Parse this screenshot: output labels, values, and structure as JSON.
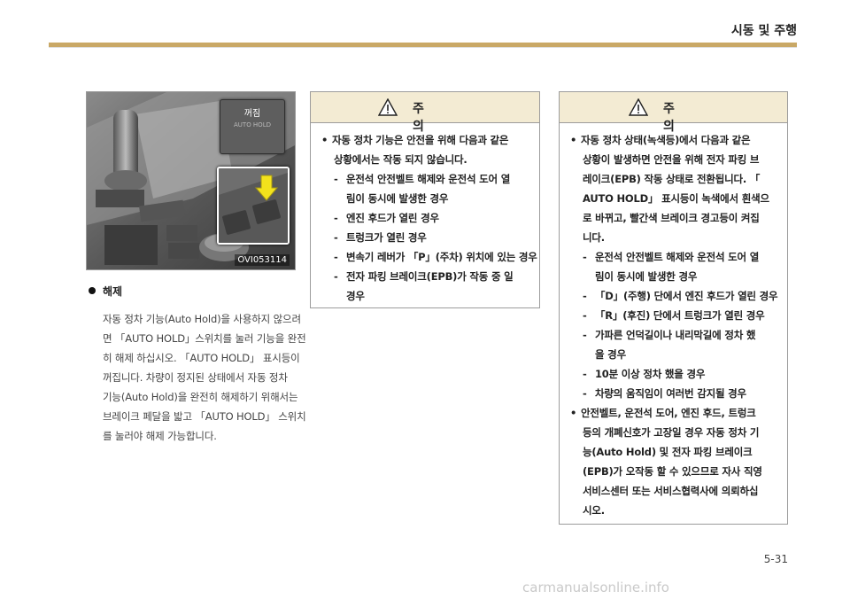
{
  "header": {
    "title": "시동 및 주행"
  },
  "photo": {
    "label_off": "꺼짐",
    "label_on": "AUTO HOLD",
    "code": "OVI053114"
  },
  "release": {
    "title": "해제",
    "lines": [
      "자동 정차 기능(Auto Hold)을 사용하지 않으려",
      "면 「AUTO HOLD」스위치를 눌러 기능을 완전",
      "히 해제 하십시오. 「AUTO HOLD」 표시등이",
      "꺼집니다. 차량이 정지된 상태에서 자동 정차",
      "기능(Auto Hold)을 완전히 해제하기 위해서는",
      "브레이크 페달을 밟고 「AUTO HOLD」 스위치",
      "를 눌러야 해제 가능합니다."
    ]
  },
  "caution_left": {
    "title": "주 의",
    "rows": [
      {
        "mark": "•",
        "indent": 0,
        "text": "자동 정차 기능은 안전을 위해 다음과 같은"
      },
      {
        "mark": "",
        "indent": 1,
        "text": "상황에서는 작동 되지 않습니다."
      },
      {
        "mark": "-",
        "indent": 1,
        "text": "운전석 안전벨트 해제와 운전석 도어 열"
      },
      {
        "mark": "",
        "indent": 2,
        "text": "림이 동시에 발생한 경우"
      },
      {
        "mark": "-",
        "indent": 1,
        "text": "엔진 후드가 열린 경우"
      },
      {
        "mark": "-",
        "indent": 1,
        "text": "트렁크가 열린 경우"
      },
      {
        "mark": "-",
        "indent": 1,
        "text": "변속기 레버가 「P」(주차) 위치에 있는 경우"
      },
      {
        "mark": "-",
        "indent": 1,
        "text": "전자 파킹 브레이크(EPB)가 작동 중 일"
      },
      {
        "mark": "",
        "indent": 2,
        "text": "경우"
      }
    ]
  },
  "caution_right": {
    "title": "주 의",
    "rows": [
      {
        "mark": "•",
        "indent": 0,
        "text": "자동 정차 상태(녹색등)에서 다음과 같은"
      },
      {
        "mark": "",
        "indent": 1,
        "text": "상황이 발생하면 안전을 위해 전자 파킹 브"
      },
      {
        "mark": "",
        "indent": 1,
        "text": "레이크(EPB) 작동 상태로 전환됩니다. 「"
      },
      {
        "mark": "",
        "indent": 1,
        "text": "AUTO HOLD」 표시등이 녹색에서 흰색으"
      },
      {
        "mark": "",
        "indent": 1,
        "text": "로 바뀌고, 빨간색 브레이크 경고등이 켜집"
      },
      {
        "mark": "",
        "indent": 1,
        "text": "니다."
      },
      {
        "mark": "-",
        "indent": 1,
        "text": "운전석 안전벨트 해제와 운전석 도어 열"
      },
      {
        "mark": "",
        "indent": 2,
        "text": "림이 동시에 발생한 경우"
      },
      {
        "mark": "-",
        "indent": 1,
        "text": "「D」(주행) 단에서 엔진 후드가 열린 경우"
      },
      {
        "mark": "-",
        "indent": 1,
        "text": "「R」(후진) 단에서 트렁크가 열린 경우"
      },
      {
        "mark": "-",
        "indent": 1,
        "text": "가파른 언덕길이나 내리막길에 정차 했"
      },
      {
        "mark": "",
        "indent": 2,
        "text": "을 경우"
      },
      {
        "mark": "-",
        "indent": 1,
        "text": "10분 이상 정차 했을 경우"
      },
      {
        "mark": "-",
        "indent": 1,
        "text": "차량의 움직임이 여러번 감지될 경우"
      },
      {
        "mark": "•",
        "indent": 0,
        "text": "안전벨트, 운전석 도어, 엔진 후드, 트렁크"
      },
      {
        "mark": "",
        "indent": 1,
        "text": "등의 개폐신호가 고장일 경우 자동 정차 기"
      },
      {
        "mark": "",
        "indent": 1,
        "text": "능(Auto Hold) 및 전자 파킹 브레이크"
      },
      {
        "mark": "",
        "indent": 1,
        "text": "(EPB)가 오작동 할 수 있으므로 자사 직영"
      },
      {
        "mark": "",
        "indent": 1,
        "text": "서비스센터 또는 서비스협력사에 의뢰하십"
      },
      {
        "mark": "",
        "indent": 1,
        "text": "시오."
      }
    ]
  },
  "footer": {
    "page": "5-31",
    "watermark": "carmanualsonline.info"
  }
}
